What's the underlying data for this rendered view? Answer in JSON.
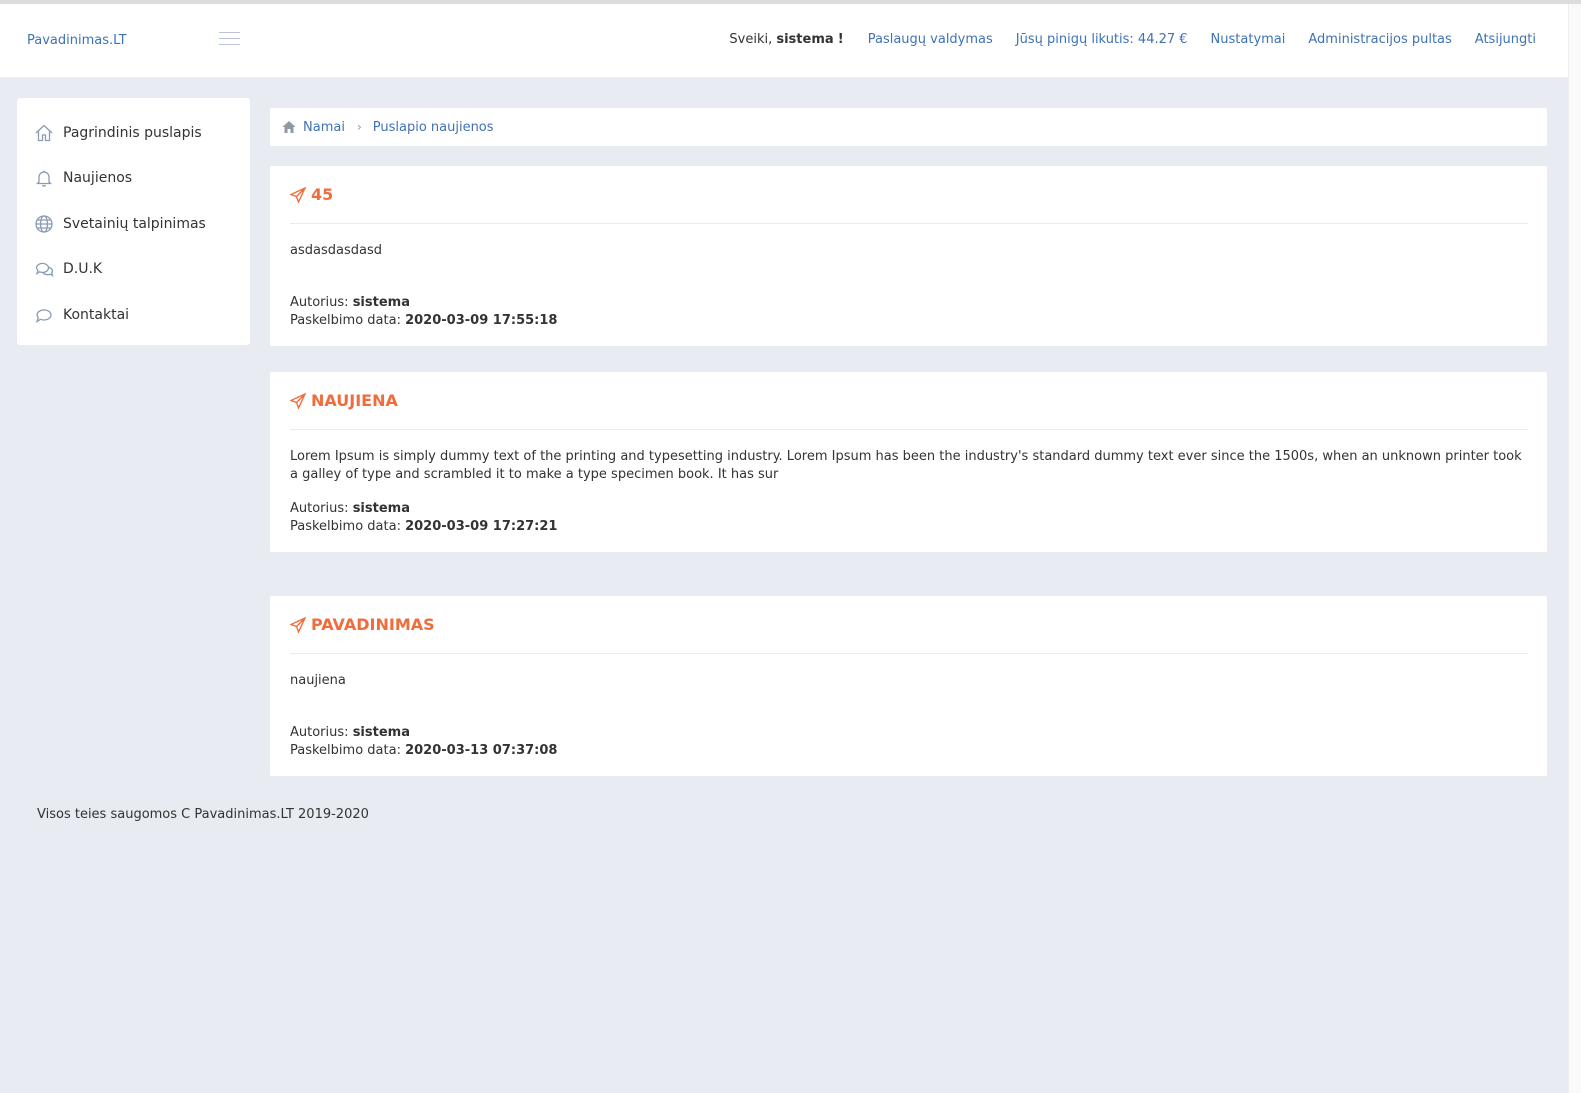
{
  "header": {
    "brand": "Pavadinimas.LT",
    "greeting_prefix": "Sveiki,",
    "greeting_user": "sistema",
    "greeting_suffix": "!",
    "links": {
      "services": "Paslaugų valdymas",
      "balance": "Jūsų pinigų likutis: 44.27 €",
      "settings": "Nustatymai",
      "admin": "Administracijos pultas",
      "logout": "Atsijungti"
    }
  },
  "sidebar": {
    "items": [
      {
        "label": "Pagrindinis puslapis",
        "icon": "home-icon"
      },
      {
        "label": "Naujienos",
        "icon": "bell-icon"
      },
      {
        "label": "Svetainių talpinimas",
        "icon": "globe-icon"
      },
      {
        "label": "D.U.K",
        "icon": "chat-icon"
      },
      {
        "label": "Kontaktai",
        "icon": "comment-icon"
      }
    ]
  },
  "breadcrumb": {
    "home": "Namai",
    "current": "Puslapio naujienos"
  },
  "news": [
    {
      "title": "45",
      "body": "asdasdasdasd",
      "author_label": "Autorius:",
      "author": "sistema",
      "date_label": "Paskelbimo data:",
      "date": "2020-03-09 17:55:18"
    },
    {
      "title": "NAUJIENA",
      "body": "Lorem Ipsum is simply dummy text of the printing and typesetting industry. Lorem Ipsum has been the industry's standard dummy text ever since the 1500s, when an unknown printer took a galley of type and scrambled it to make a type specimen book. It has sur",
      "author_label": "Autorius:",
      "author": "sistema",
      "date_label": "Paskelbimo data:",
      "date": "2020-03-09 17:27:21"
    },
    {
      "title": "PAVADINIMAS",
      "body": "naujiena",
      "author_label": "Autorius:",
      "author": "sistema",
      "date_label": "Paskelbimo data:",
      "date": "2020-03-13 07:37:08"
    }
  ],
  "footer": {
    "text": "Visos teies saugomos C Pavadinimas.LT 2019-2020"
  },
  "colors": {
    "accent": "#f16c3d",
    "link": "#3f72b6",
    "background": "#e8ebf2"
  }
}
